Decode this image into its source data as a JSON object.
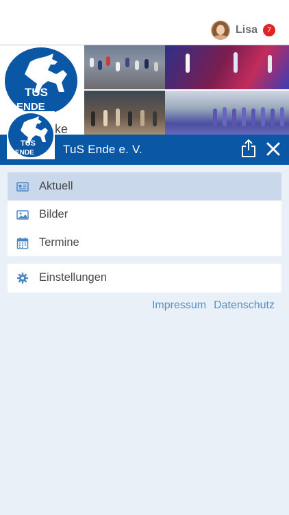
{
  "header": {
    "user_name": "Lisa",
    "notification_count": "7"
  },
  "banner": {
    "logo_line1": "TUS",
    "logo_line2": "ENDE",
    "partial_text": "ke"
  },
  "brandbar": {
    "logo_line1": "TUS",
    "logo_line2": "ENDE",
    "title": "TuS Ende e. V."
  },
  "menu": {
    "items": [
      {
        "label": "Aktuell",
        "icon": "newspaper-icon",
        "active": true
      },
      {
        "label": "Bilder",
        "icon": "image-icon",
        "active": false
      },
      {
        "label": "Termine",
        "icon": "calendar-icon",
        "active": false
      }
    ],
    "settings": {
      "label": "Einstellungen",
      "icon": "gear-icon"
    }
  },
  "footer_links": {
    "impressum": "Impressum",
    "datenschutz": "Datenschutz"
  },
  "colors": {
    "brand_blue": "#0a57a6",
    "active_row": "#c9d8ea",
    "background": "#eaf0f8",
    "link": "#5b8ec2",
    "icon": "#4a86c5",
    "badge": "#e02424"
  }
}
